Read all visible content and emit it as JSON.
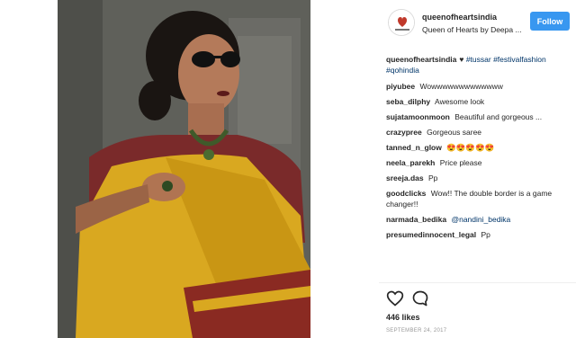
{
  "header": {
    "username": "queenofheartsindia",
    "subtitle": "Queen of Hearts by Deepa ...",
    "follow_label": "Follow"
  },
  "caption": {
    "username": "queenofheartsindia",
    "heart": "♥",
    "tags": [
      "#tussar",
      "#festivalfashion",
      "#qohindia"
    ]
  },
  "comments": [
    {
      "user": "piyubee",
      "text": "Wowwwwwwwwwwwww"
    },
    {
      "user": "seba_dilphy",
      "text": "Awesome look"
    },
    {
      "user": "sujatamoonmoon",
      "text": "Beautiful and gorgeous ..."
    },
    {
      "user": "crazypree",
      "text": "Gorgeous saree"
    },
    {
      "user": "tanned_n_glow",
      "text": "😍😍😍😍😍"
    },
    {
      "user": "neela_parekh",
      "text": "Price please"
    },
    {
      "user": "sreeja.das",
      "text": "Pp"
    },
    {
      "user": "goodclicks",
      "text": "Wow!! The double border is a game changer!!"
    },
    {
      "user": "narmada_bedika",
      "mention": "@nandini_bedika"
    },
    {
      "user": "presumedinnocent_legal",
      "text": "Pp"
    }
  ],
  "likes": "446 likes",
  "date": "SEPTEMBER 24, 2017",
  "icons": {
    "like": "heart-icon",
    "comment": "speech-bubble-icon"
  },
  "colors": {
    "follow_button": "#3897f0",
    "hashtag": "#003569",
    "saree": "#d9a820",
    "blouse": "#7a2a2a"
  }
}
